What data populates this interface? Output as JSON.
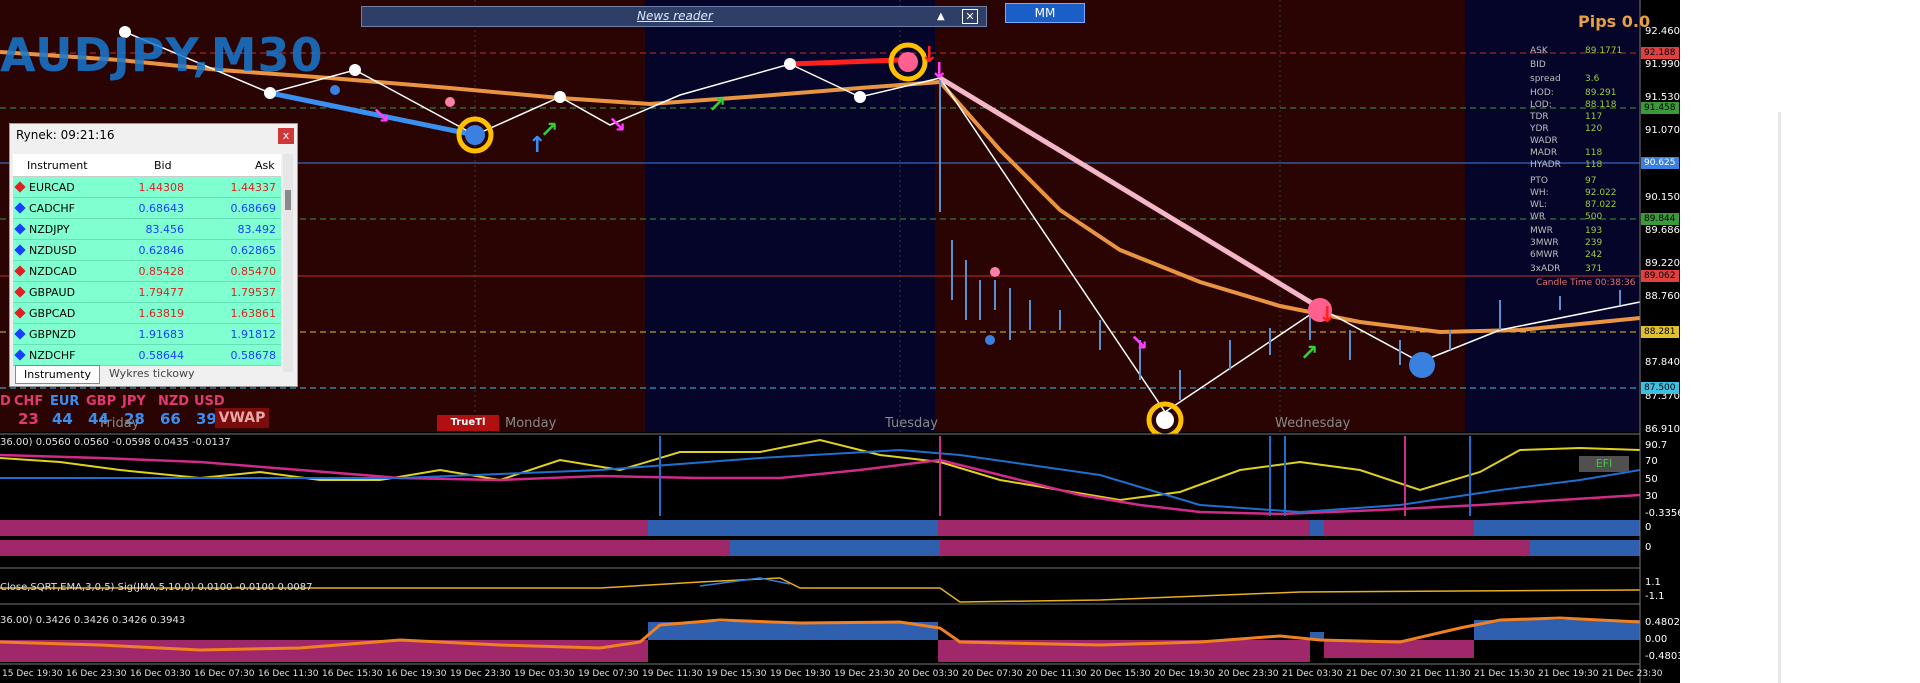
{
  "chart": {
    "symbol_timeframe": "AUDJPY,M30",
    "pips_label": "Pips 0.0",
    "news_reader_label": "News reader",
    "mm_label": "MM",
    "vwap_label": "VWAP",
    "truetl_label": "TrueTl",
    "efi_label": "EFI",
    "days": [
      "Friday",
      "Monday",
      "Tuesday",
      "Wednesday"
    ],
    "currencies": [
      {
        "name": "D",
        "value": ""
      },
      {
        "name": "CHF",
        "value": "23"
      },
      {
        "name": "EUR",
        "value": "44"
      },
      {
        "name": "GBP",
        "value": "44"
      },
      {
        "name": "JPY",
        "value": "28"
      },
      {
        "name": "NZD",
        "value": "66"
      },
      {
        "name": "USD",
        "value": "39"
      }
    ],
    "price_axis": [
      "92.460",
      "91.990",
      "91.530",
      "91.070",
      "90.150",
      "89.686",
      "89.220",
      "88.760",
      "87.840",
      "87.370",
      "86.910"
    ],
    "price_boxes": [
      {
        "text": "92.188",
        "color": "#e04040"
      },
      {
        "text": "91.458",
        "color": "#3a9a3a"
      },
      {
        "text": "90.625",
        "color": "#3a80e0"
      },
      {
        "text": "89.844",
        "color": "#3a9a3a"
      },
      {
        "text": "89.062",
        "color": "#e04040"
      },
      {
        "text": "88.281",
        "color": "#e0c030"
      },
      {
        "text": "87.500",
        "color": "#40c0e0"
      }
    ],
    "stats": [
      {
        "k": "ASK",
        "v": "89.1771"
      },
      {
        "k": "BID",
        "v": ""
      },
      {
        "k": "spread",
        "v": "3.6"
      },
      {
        "k": "HOD:",
        "v": "89.291"
      },
      {
        "k": "LOD:",
        "v": "88.118"
      },
      {
        "k": "TDR",
        "v": "117"
      },
      {
        "k": "YDR",
        "v": "120"
      },
      {
        "k": "WADR",
        "v": ""
      },
      {
        "k": "MADR",
        "v": "118"
      },
      {
        "k": "HYADR",
        "v": "118"
      },
      {
        "k": "PTO",
        "v": "97"
      },
      {
        "k": "WH:",
        "v": "92.022"
      },
      {
        "k": "WL:",
        "v": "87.022"
      },
      {
        "k": "WR",
        "v": "500"
      },
      {
        "k": "MWR",
        "v": "193"
      },
      {
        "k": "3MWR",
        "v": "239"
      },
      {
        "k": "6MWR",
        "v": "242"
      },
      {
        "k": "3xADR",
        "v": "371"
      }
    ],
    "candle_time": "Candle Time 00:38:36",
    "ind1_label": "36.00) 0.0560 0.0560 -0.0598 0.0435 -0.0137",
    "ind1_axis": [
      "90.7",
      "70",
      "50",
      "30",
      "-0.3356"
    ],
    "ind2_axis": [
      "0",
      "0"
    ],
    "ind3_label": "Close,SQRT,EMA,3,0,5) Sig(JMA,5,10,0) 0.0100 -0.0100 0.0087",
    "ind3_axis": [
      "1.1",
      "-1.1"
    ],
    "ind4_label": "36.00) 0.3426 0.3426 0.3426 0.3943",
    "ind4_axis": [
      "0.4802",
      "0.00",
      "-0.4803"
    ],
    "time_axis": [
      "15 Dec 19:30",
      "16 Dec 23:30",
      "16 Dec 03:30",
      "16 Dec 07:30",
      "16 Dec 11:30",
      "16 Dec 15:30",
      "16 Dec 19:30",
      "19 Dec 23:30",
      "19 Dec 03:30",
      "19 Dec 07:30",
      "19 Dec 11:30",
      "19 Dec 15:30",
      "19 Dec 19:30",
      "19 Dec 23:30",
      "20 Dec 03:30",
      "20 Dec 07:30",
      "20 Dec 11:30",
      "20 Dec 15:30",
      "20 Dec 19:30",
      "20 Dec 23:30",
      "21 Dec 03:30",
      "21 Dec 07:30",
      "21 Dec 11:30",
      "21 Dec 15:30",
      "21 Dec 19:30",
      "21 Dec 23:30"
    ]
  },
  "market_watch": {
    "title": "Rynek: 09:21:16",
    "close_label": "x",
    "col_instrument": "Instrument",
    "col_bid": "Bid",
    "col_ask": "Ask",
    "rows": [
      {
        "symbol": "EURCAD",
        "bid": "1.44308",
        "ask": "1.44337",
        "dir": "down"
      },
      {
        "symbol": "CADCHF",
        "bid": "0.68643",
        "ask": "0.68669",
        "dir": "up"
      },
      {
        "symbol": "NZDJPY",
        "bid": "83.456",
        "ask": "83.492",
        "dir": "up"
      },
      {
        "symbol": "NZDUSD",
        "bid": "0.62846",
        "ask": "0.62865",
        "dir": "up"
      },
      {
        "symbol": "NZDCAD",
        "bid": "0.85428",
        "ask": "0.85470",
        "dir": "down"
      },
      {
        "symbol": "GBPAUD",
        "bid": "1.79477",
        "ask": "1.79537",
        "dir": "down"
      },
      {
        "symbol": "GBPCAD",
        "bid": "1.63819",
        "ask": "1.63861",
        "dir": "down"
      },
      {
        "symbol": "GBPNZD",
        "bid": "1.91683",
        "ask": "1.91812",
        "dir": "up"
      },
      {
        "symbol": "NZDCHF",
        "bid": "0.58644",
        "ask": "0.58678",
        "dir": "up"
      }
    ],
    "tab_instruments": "Instrumenty",
    "tab_tick_chart": "Wykres tickowy"
  },
  "colors": {
    "up": "#1a40ff",
    "down": "#e02020",
    "bg_red": "#2a0303",
    "bg_blue": "#05052a"
  }
}
